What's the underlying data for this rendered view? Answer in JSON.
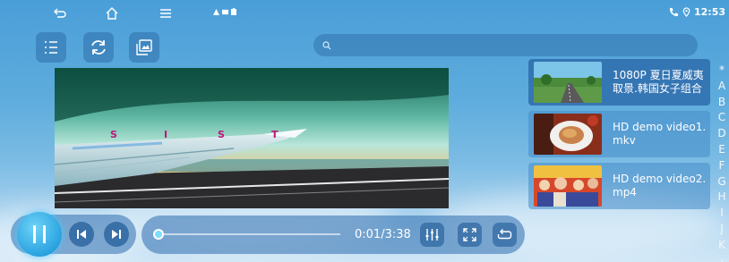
{
  "status_bar": {
    "clock": "12:53",
    "icons": [
      "back-icon",
      "home-icon",
      "menu-icon",
      "phone-icon",
      "location-icon"
    ]
  },
  "toolbar": {
    "buttons": [
      "playlist-icon",
      "refresh-icon",
      "gallery-icon"
    ]
  },
  "search": {
    "placeholder": "",
    "value": ""
  },
  "video": {
    "overlay_text": [
      "S",
      "I",
      "S",
      "T"
    ]
  },
  "playlist": {
    "items": [
      {
        "title": "1080P 夏日夏威夷取景.韩国女子组合",
        "active": true,
        "thumb": "road-thumbnail"
      },
      {
        "title": "HD demo video1.mkv",
        "active": false,
        "thumb": "food-thumbnail"
      },
      {
        "title": "HD demo video2.mp4",
        "active": false,
        "thumb": "crowd-thumbnail"
      }
    ]
  },
  "alphabet_index": [
    "*",
    "A",
    "B",
    "C",
    "D",
    "E",
    "F",
    "G",
    "H",
    "I",
    "J",
    "K",
    "·"
  ],
  "player": {
    "time": "0:01/3:38",
    "progress": 0.005,
    "state": "playing",
    "buttons": [
      "pause-icon",
      "previous-icon",
      "next-icon",
      "equalizer-icon",
      "fullscreen-icon",
      "repeat-icon"
    ]
  },
  "colors": {
    "accent": "#2aa3e0",
    "progress_fill": "#6fd6ff",
    "overlay_letter": "#c0157a"
  }
}
